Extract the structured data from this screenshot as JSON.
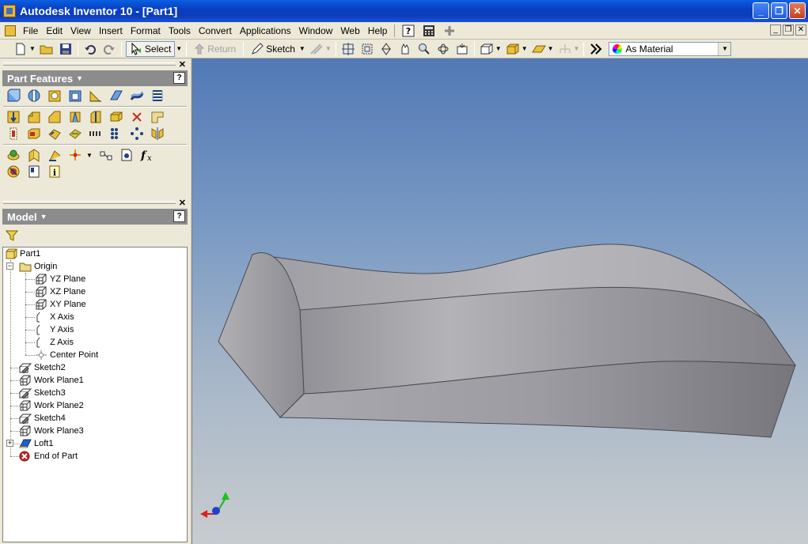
{
  "window": {
    "title": "Autodesk Inventor 10 - [Part1]",
    "buttons": [
      "_",
      "❐",
      "✕"
    ]
  },
  "menu": {
    "items": [
      "File",
      "Edit",
      "View",
      "Insert",
      "Format",
      "Tools",
      "Convert",
      "Applications",
      "Window",
      "Web",
      "Help"
    ]
  },
  "toolbar": {
    "select_label": "Select",
    "return_label": "Return",
    "sketch_label": "Sketch",
    "material_value": "As Material"
  },
  "part_features": {
    "title": "Part Features",
    "help": "?"
  },
  "model": {
    "title": "Model",
    "help": "?"
  },
  "tree": [
    {
      "label": "Part1",
      "icon": "part-icon"
    },
    {
      "label": "Origin",
      "icon": "folder-icon"
    },
    {
      "label": "YZ Plane",
      "icon": "plane-icon"
    },
    {
      "label": "XZ Plane",
      "icon": "plane-icon"
    },
    {
      "label": "XY Plane",
      "icon": "plane-icon"
    },
    {
      "label": "X Axis",
      "icon": "axis-icon"
    },
    {
      "label": "Y Axis",
      "icon": "axis-icon"
    },
    {
      "label": "Z Axis",
      "icon": "axis-icon"
    },
    {
      "label": "Center Point",
      "icon": "point-icon"
    },
    {
      "label": "Sketch2",
      "icon": "sketch-icon"
    },
    {
      "label": "Work Plane1",
      "icon": "workplane-icon"
    },
    {
      "label": "Sketch3",
      "icon": "sketch-icon"
    },
    {
      "label": "Work Plane2",
      "icon": "workplane-icon"
    },
    {
      "label": "Sketch4",
      "icon": "sketch-icon"
    },
    {
      "label": "Work Plane3",
      "icon": "workplane-icon"
    },
    {
      "label": "Loft1",
      "icon": "loft-icon"
    },
    {
      "label": "End of Part",
      "icon": "end-of-part-icon"
    }
  ],
  "colors": {
    "titlebar": "#0a3fc4",
    "panel_header": "#8c8c8c",
    "viewport_top": "#5279b5",
    "viewport_bottom": "#c8cccf"
  }
}
